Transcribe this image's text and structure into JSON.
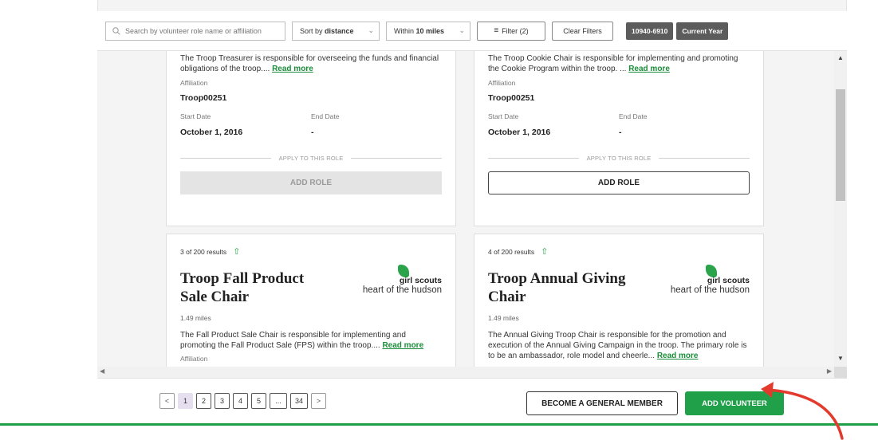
{
  "toolbar": {
    "search_placeholder": "Search by volunteer role name or affiliation",
    "sort_prefix": "Sort by",
    "sort_value": "distance",
    "within_prefix": "Within",
    "within_value": "10 miles",
    "filter_label": "Filter (2)",
    "clear_label": "Clear Filters",
    "badge_code": "10940-6910",
    "badge_year": "Current Year"
  },
  "cards_top": [
    {
      "description": "The Troop Treasurer is responsible for overseeing the funds and financial obligations of the troop....",
      "read_more": "Read more",
      "affiliation_label": "Affiliation",
      "affiliation": "Troop00251",
      "start_label": "Start Date",
      "start_date": "October 1, 2016",
      "end_label": "End Date",
      "end_date": "-",
      "apply_label": "APPLY TO THIS ROLE",
      "add_role": "ADD ROLE"
    },
    {
      "description": "The Troop Cookie Chair is responsible for implementing and promoting the Cookie Program within the troop.  ...",
      "read_more": "Read more",
      "affiliation_label": "Affiliation",
      "affiliation": "Troop00251",
      "start_label": "Start Date",
      "start_date": "October 1, 2016",
      "end_label": "End Date",
      "end_date": "-",
      "apply_label": "APPLY TO THIS ROLE",
      "add_role": "ADD ROLE"
    }
  ],
  "cards_bottom": [
    {
      "count": "3 of 200 results",
      "title_line1": "Troop Fall Product",
      "title_line2": "Sale Chair",
      "logo_line1": "girl scouts",
      "logo_line2": "heart of the hudson",
      "miles": "1.49 miles",
      "description": "The Fall Product Sale Chair is responsible for implementing and promoting the Fall Product Sale (FPS) within the troop....",
      "read_more": "Read more",
      "affiliation_label": "Affiliation"
    },
    {
      "count": "4 of 200 results",
      "title_line1": "Troop Annual Giving",
      "title_line2": "Chair",
      "logo_line1": "girl scouts",
      "logo_line2": "heart of the hudson",
      "miles": "1.49 miles",
      "description": "The Annual Giving Troop Chair is responsible for the promotion and execution of the Annual Giving Campaign in the troop.  The primary role is to be an ambassador, role model and cheerle...",
      "read_more": "Read more"
    }
  ],
  "pagination": {
    "prev": "<",
    "pages": [
      "1",
      "2",
      "3",
      "4",
      "5",
      "...",
      "34"
    ],
    "next": ">",
    "current": "1"
  },
  "footer": {
    "general_member": "BECOME A GENERAL MEMBER",
    "add_volunteer": "ADD VOLUNTEER"
  },
  "colors": {
    "brand_green": "#21a04a",
    "annotation_arrow": "#e23b2e"
  }
}
